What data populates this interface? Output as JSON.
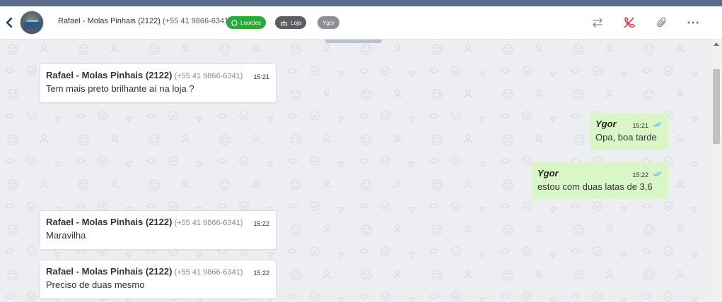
{
  "header": {
    "contact_name": "Rafael - Molas Pinhais (2122)",
    "contact_phone": "(+55 41 9866-6341)",
    "tags": [
      {
        "label": "Lourdes",
        "color": "#29a83b",
        "icon": "whatsapp-icon"
      },
      {
        "label": "Loja",
        "color": "#5a5e63",
        "icon": "sitemap-icon"
      },
      {
        "label": "Ygor",
        "color": "#8b8f94"
      }
    ],
    "actions": [
      "transfer-icon",
      "end-call-icon",
      "attach-icon",
      "more-icon"
    ]
  },
  "messages": [
    {
      "direction": "in",
      "sender": "Rafael - Molas Pinhais (2122)",
      "phone": "(+55 41 9866-6341)",
      "time": "15:21",
      "text": "Tem mais preto brilhante aí na loja ?"
    },
    {
      "direction": "out",
      "sender": "Ygor",
      "time": "15:21",
      "text": "Opa, boa tarde",
      "status": "double-check-icon"
    },
    {
      "direction": "out",
      "sender": "Ygor",
      "time": "15:22",
      "text": "estou com duas latas de 3,6",
      "status": "double-check-icon"
    },
    {
      "direction": "in",
      "sender": "Rafael - Molas Pinhais (2122)",
      "phone": "(+55 41 9866-6341)",
      "time": "15:22",
      "text": "Maravilha"
    },
    {
      "direction": "in",
      "sender": "Rafael - Molas Pinhais (2122)",
      "phone": "(+55 41 9866-6341)",
      "time": "15:22",
      "text": "Preciso de duas mesmo"
    }
  ]
}
